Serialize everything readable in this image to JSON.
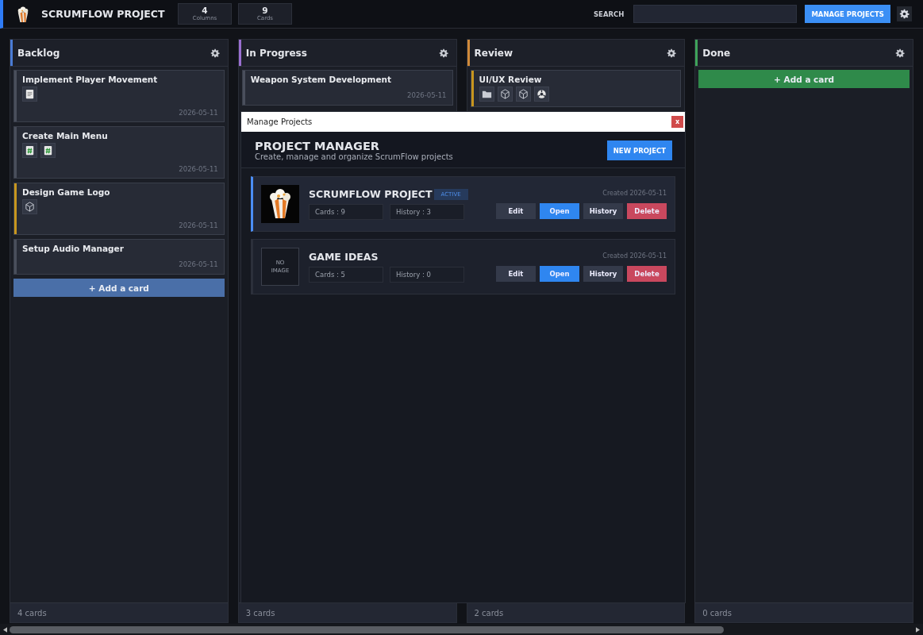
{
  "header": {
    "title": "SCRUMFLOW PROJECT",
    "stats": [
      {
        "value": "4",
        "label": "Columns"
      },
      {
        "value": "9",
        "label": "Cards"
      }
    ],
    "search_label": "SEARCH",
    "manage_button": "MANAGE PROJECTS"
  },
  "columns": [
    {
      "title": "Backlog",
      "color": "#4a7bd4",
      "add_label": "+ Add a card",
      "footer": "4 cards",
      "cards": [
        {
          "title": "Implement Player Movement",
          "date": "2026-05-11",
          "color": "#4a4f5c",
          "attachments": [
            {
              "kind": "doc"
            }
          ]
        },
        {
          "title": "Create Main Menu",
          "date": "2026-05-11",
          "color": "#4a4f5c",
          "attachments": [
            {
              "kind": "code"
            },
            {
              "kind": "code"
            }
          ]
        },
        {
          "title": "Design Game Logo",
          "date": "2026-05-11",
          "color": "#c8961e",
          "attachments": [
            {
              "kind": "cube"
            }
          ]
        },
        {
          "title": "Setup Audio Manager",
          "date": "2026-05-11",
          "color": "#4a4f5c"
        }
      ]
    },
    {
      "title": "In Progress",
      "color": "#9a6fd0",
      "footer": "3 cards",
      "cards": [
        {
          "title": "Weapon System Development",
          "date": "2026-05-11",
          "color": "#4a4f5c"
        }
      ]
    },
    {
      "title": "Review",
      "color": "#d08a3a",
      "footer": "2 cards",
      "cards": [
        {
          "title": "UI/UX Review",
          "color": "#c8961e",
          "attachments": [
            {
              "kind": "folder"
            },
            {
              "kind": "cube"
            },
            {
              "kind": "cube"
            },
            {
              "kind": "hub"
            }
          ]
        }
      ]
    },
    {
      "title": "Done",
      "color": "#3fa35a",
      "add_label": "+ Add a card",
      "footer": "0 cards"
    }
  ],
  "dialog": {
    "title": "Manage Projects",
    "close": "x",
    "heading": "PROJECT MANAGER",
    "subheading": "Create, manage and organize ScrumFlow projects",
    "new_button": "NEW PROJECT",
    "projects": [
      {
        "name": "SCRUMFLOW PROJECT",
        "active": true,
        "badge": "ACTIVE",
        "cards": "Cards : 9",
        "history": "History : 3",
        "created": "Created 2026-05-11",
        "actions": [
          "Edit",
          "Open",
          "History",
          "Delete"
        ]
      },
      {
        "name": "GAME IDEAS",
        "active": false,
        "image": {
          "kind": "none",
          "label": "NO\nIMAGE"
        },
        "cards": "Cards : 5",
        "history": "History : 0",
        "created": "Created 2026-05-11",
        "actions": [
          "Edit",
          "Open",
          "History",
          "Delete"
        ]
      }
    ]
  }
}
